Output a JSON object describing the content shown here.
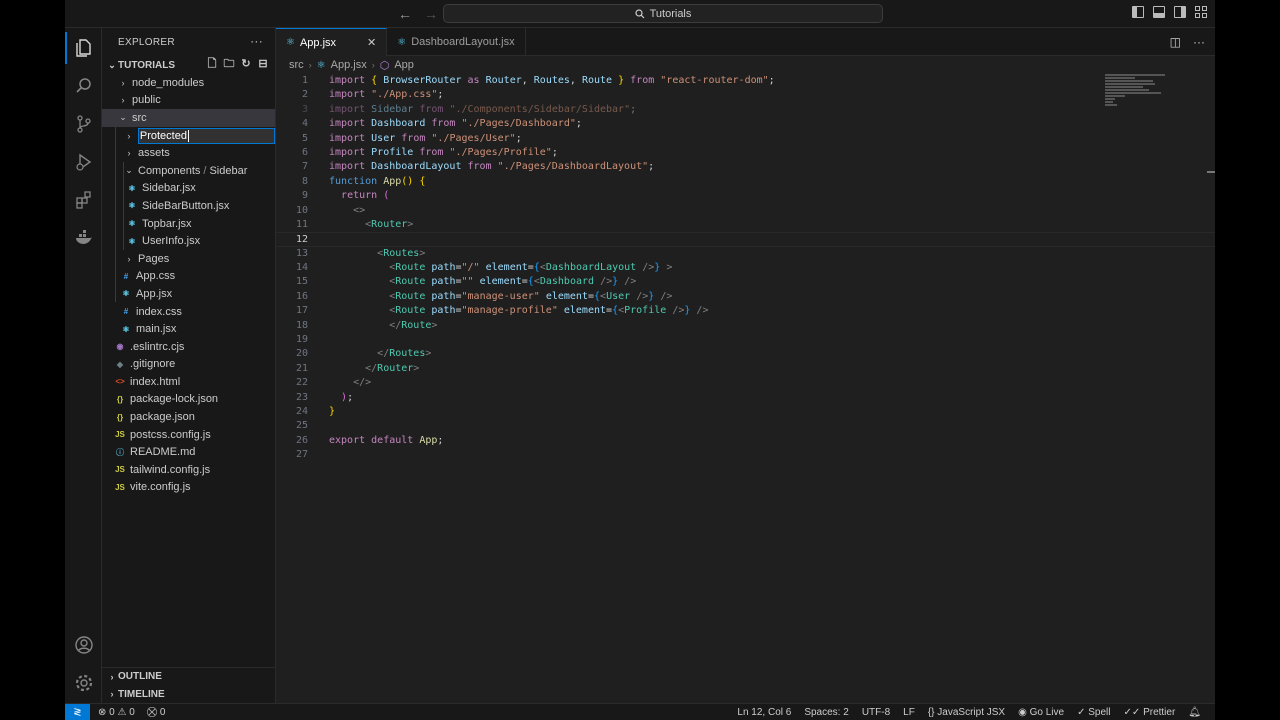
{
  "titlebar": {
    "search_text": "Tutorials",
    "back": "←",
    "forward": "→"
  },
  "sidebar": {
    "title": "EXPLORER",
    "more": "···",
    "project": "TUTORIALS",
    "tree": {
      "node_modules": "node_modules",
      "public": "public",
      "src": "src",
      "rename_value": "Protected",
      "assets": "assets",
      "components": "Components",
      "components_sub": "Sidebar",
      "sidebar_jsx": "Sidebar.jsx",
      "sidebarbutton_jsx": "SideBarButton.jsx",
      "topbar_jsx": "Topbar.jsx",
      "userinfo_jsx": "UserInfo.jsx",
      "pages": "Pages",
      "app_css": "App.css",
      "app_jsx": "App.jsx",
      "index_css": "index.css",
      "main_jsx": "main.jsx",
      "eslintrc": ".eslintrc.cjs",
      "gitignore": ".gitignore",
      "index_html": "index.html",
      "package_lock": "package-lock.json",
      "package_json": "package.json",
      "postcss": "postcss.config.js",
      "readme": "README.md",
      "tailwind": "tailwind.config.js",
      "vite": "vite.config.js"
    },
    "outline": "OUTLINE",
    "timeline": "TIMELINE"
  },
  "tabs": [
    {
      "label": "App.jsx"
    },
    {
      "label": "DashboardLayout.jsx"
    }
  ],
  "breadcrumb": {
    "folder": "src",
    "file": "App.jsx",
    "symbol": "App"
  },
  "code": {
    "l1_a": "import",
    "l1_b": "BrowserRouter",
    "l1_c": "as",
    "l1_d": "Router",
    "l1_e": "Routes",
    "l1_f": "Route",
    "l1_g": "from",
    "l1_h": "\"react-router-dom\"",
    "l2": "\"./App.css\"",
    "l3_a": "Sidebar",
    "l3_b": "\"./Components/Sidebar/Sidebar\"",
    "l4_a": "Dashboard",
    "l4_b": "\"./Pages/Dashboard\"",
    "l5_a": "User",
    "l5_b": "\"./Pages/User\"",
    "l6_a": "Profile",
    "l6_b": "\"./Pages/Profile\"",
    "l7_a": "DashboardLayout",
    "l7_b": "\"./Pages/DashboardLayout\"",
    "l8_a": "function",
    "l8_b": "App",
    "l9": "return",
    "l11": "Router",
    "l13": "Routes",
    "route": "Route",
    "path": "path",
    "element": "element",
    "p14": "\"/\"",
    "p15": "\"\"",
    "p16": "\"manage-user\"",
    "p17": "\"manage-profile\"",
    "c14": "DashboardLayout",
    "c15": "Dashboard",
    "c16": "User",
    "c17": "Profile",
    "l26_a": "export",
    "l26_b": "default",
    "l26_c": "App"
  },
  "status": {
    "errors": "0",
    "warnings": "0",
    "ports": "0",
    "position": "Ln 12, Col 6",
    "spaces": "Spaces: 2",
    "encoding": "UTF-8",
    "eol": "LF",
    "language": "JavaScript JSX",
    "golive": "Go Live",
    "spell": "Spell",
    "prettier": "Prettier"
  },
  "colors": {
    "accent": "#0078d4",
    "keyword": "#c586c0",
    "string": "#ce9178",
    "component": "#4ec9b0"
  }
}
